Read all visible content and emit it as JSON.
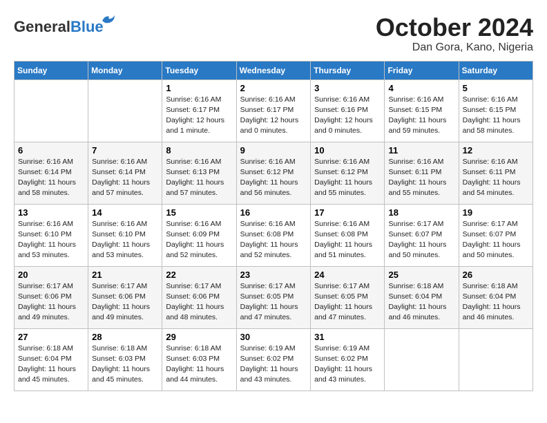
{
  "logo": {
    "general": "General",
    "blue": "Blue"
  },
  "title": "October 2024",
  "location": "Dan Gora, Kano, Nigeria",
  "days_of_week": [
    "Sunday",
    "Monday",
    "Tuesday",
    "Wednesday",
    "Thursday",
    "Friday",
    "Saturday"
  ],
  "weeks": [
    [
      {
        "num": "",
        "info": ""
      },
      {
        "num": "",
        "info": ""
      },
      {
        "num": "1",
        "info": "Sunrise: 6:16 AM\nSunset: 6:17 PM\nDaylight: 12 hours\nand 1 minute."
      },
      {
        "num": "2",
        "info": "Sunrise: 6:16 AM\nSunset: 6:17 PM\nDaylight: 12 hours\nand 0 minutes."
      },
      {
        "num": "3",
        "info": "Sunrise: 6:16 AM\nSunset: 6:16 PM\nDaylight: 12 hours\nand 0 minutes."
      },
      {
        "num": "4",
        "info": "Sunrise: 6:16 AM\nSunset: 6:15 PM\nDaylight: 11 hours\nand 59 minutes."
      },
      {
        "num": "5",
        "info": "Sunrise: 6:16 AM\nSunset: 6:15 PM\nDaylight: 11 hours\nand 58 minutes."
      }
    ],
    [
      {
        "num": "6",
        "info": "Sunrise: 6:16 AM\nSunset: 6:14 PM\nDaylight: 11 hours\nand 58 minutes."
      },
      {
        "num": "7",
        "info": "Sunrise: 6:16 AM\nSunset: 6:14 PM\nDaylight: 11 hours\nand 57 minutes."
      },
      {
        "num": "8",
        "info": "Sunrise: 6:16 AM\nSunset: 6:13 PM\nDaylight: 11 hours\nand 57 minutes."
      },
      {
        "num": "9",
        "info": "Sunrise: 6:16 AM\nSunset: 6:12 PM\nDaylight: 11 hours\nand 56 minutes."
      },
      {
        "num": "10",
        "info": "Sunrise: 6:16 AM\nSunset: 6:12 PM\nDaylight: 11 hours\nand 55 minutes."
      },
      {
        "num": "11",
        "info": "Sunrise: 6:16 AM\nSunset: 6:11 PM\nDaylight: 11 hours\nand 55 minutes."
      },
      {
        "num": "12",
        "info": "Sunrise: 6:16 AM\nSunset: 6:11 PM\nDaylight: 11 hours\nand 54 minutes."
      }
    ],
    [
      {
        "num": "13",
        "info": "Sunrise: 6:16 AM\nSunset: 6:10 PM\nDaylight: 11 hours\nand 53 minutes."
      },
      {
        "num": "14",
        "info": "Sunrise: 6:16 AM\nSunset: 6:10 PM\nDaylight: 11 hours\nand 53 minutes."
      },
      {
        "num": "15",
        "info": "Sunrise: 6:16 AM\nSunset: 6:09 PM\nDaylight: 11 hours\nand 52 minutes."
      },
      {
        "num": "16",
        "info": "Sunrise: 6:16 AM\nSunset: 6:08 PM\nDaylight: 11 hours\nand 52 minutes."
      },
      {
        "num": "17",
        "info": "Sunrise: 6:16 AM\nSunset: 6:08 PM\nDaylight: 11 hours\nand 51 minutes."
      },
      {
        "num": "18",
        "info": "Sunrise: 6:17 AM\nSunset: 6:07 PM\nDaylight: 11 hours\nand 50 minutes."
      },
      {
        "num": "19",
        "info": "Sunrise: 6:17 AM\nSunset: 6:07 PM\nDaylight: 11 hours\nand 50 minutes."
      }
    ],
    [
      {
        "num": "20",
        "info": "Sunrise: 6:17 AM\nSunset: 6:06 PM\nDaylight: 11 hours\nand 49 minutes."
      },
      {
        "num": "21",
        "info": "Sunrise: 6:17 AM\nSunset: 6:06 PM\nDaylight: 11 hours\nand 49 minutes."
      },
      {
        "num": "22",
        "info": "Sunrise: 6:17 AM\nSunset: 6:06 PM\nDaylight: 11 hours\nand 48 minutes."
      },
      {
        "num": "23",
        "info": "Sunrise: 6:17 AM\nSunset: 6:05 PM\nDaylight: 11 hours\nand 47 minutes."
      },
      {
        "num": "24",
        "info": "Sunrise: 6:17 AM\nSunset: 6:05 PM\nDaylight: 11 hours\nand 47 minutes."
      },
      {
        "num": "25",
        "info": "Sunrise: 6:18 AM\nSunset: 6:04 PM\nDaylight: 11 hours\nand 46 minutes."
      },
      {
        "num": "26",
        "info": "Sunrise: 6:18 AM\nSunset: 6:04 PM\nDaylight: 11 hours\nand 46 minutes."
      }
    ],
    [
      {
        "num": "27",
        "info": "Sunrise: 6:18 AM\nSunset: 6:04 PM\nDaylight: 11 hours\nand 45 minutes."
      },
      {
        "num": "28",
        "info": "Sunrise: 6:18 AM\nSunset: 6:03 PM\nDaylight: 11 hours\nand 45 minutes."
      },
      {
        "num": "29",
        "info": "Sunrise: 6:18 AM\nSunset: 6:03 PM\nDaylight: 11 hours\nand 44 minutes."
      },
      {
        "num": "30",
        "info": "Sunrise: 6:19 AM\nSunset: 6:02 PM\nDaylight: 11 hours\nand 43 minutes."
      },
      {
        "num": "31",
        "info": "Sunrise: 6:19 AM\nSunset: 6:02 PM\nDaylight: 11 hours\nand 43 minutes."
      },
      {
        "num": "",
        "info": ""
      },
      {
        "num": "",
        "info": ""
      }
    ]
  ]
}
